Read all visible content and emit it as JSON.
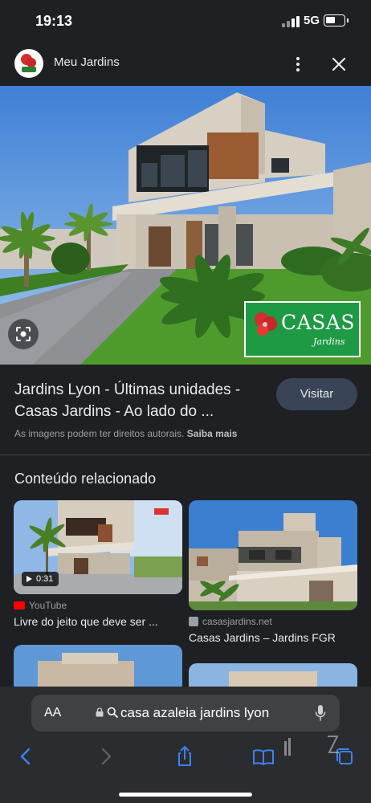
{
  "status_bar": {
    "time": "19:13",
    "network": "5G"
  },
  "header": {
    "site_name": "Meu Jardins"
  },
  "image_result": {
    "badge_brand": "CASAS",
    "badge_sub": "Jardins",
    "title": "Jardins Lyon - Últimas unidades - Casas Jardins - Ao lado do ...",
    "visit_label": "Visitar",
    "copyright_text": "As imagens podem ter direitos autorais.",
    "learn_more": "Saiba mais"
  },
  "related": {
    "heading": "Conteúdo relacionado",
    "items": [
      {
        "source": "YouTube",
        "title": "Livre do jeito que deve ser ...",
        "duration": "0:31"
      },
      {
        "source": "casasjardins.net",
        "title": "Casas Jardins – Jardins FGR"
      }
    ]
  },
  "address_bar": {
    "aa": "AA",
    "url": "casa azaleia jardins lyon"
  },
  "icons": {
    "status": [
      "signal-icon",
      "battery-icon"
    ],
    "header": [
      "site-logo-icon",
      "more-vert-icon",
      "close-icon"
    ],
    "hero": [
      "lens-icon"
    ],
    "toolbar": [
      "back-icon",
      "forward-icon",
      "share-icon",
      "bookmarks-icon",
      "tabs-icon",
      "lock-icon",
      "search-icon",
      "mic-icon"
    ]
  },
  "colors": {
    "background": "#1f2023",
    "visit_button": "#394457",
    "brand_green": "#1e9a45",
    "accent_blue": "#3b82f6",
    "youtube_red": "#ff0000"
  }
}
